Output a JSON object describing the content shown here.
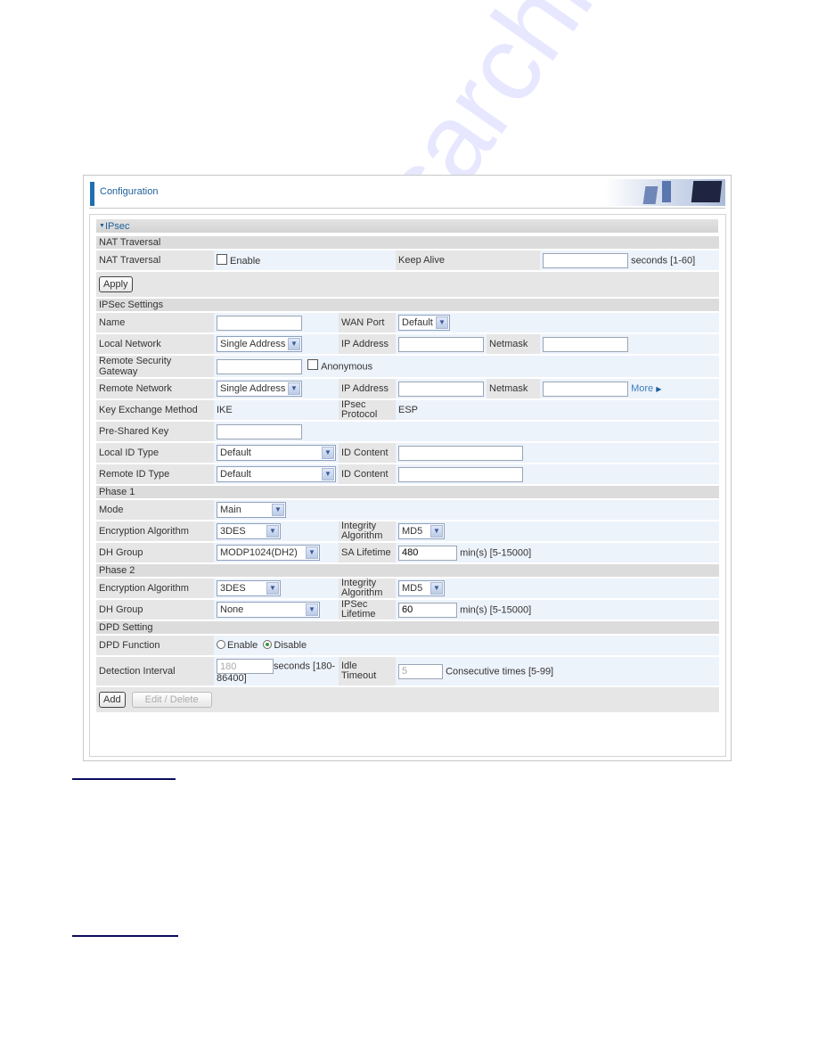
{
  "header": {
    "title": "Configuration",
    "banner": "office-chairs-monitor-banner"
  },
  "section": {
    "title": "IPsec",
    "expand_icon": "triangle-down-icon"
  },
  "nat": {
    "group": "NAT Traversal",
    "label": "NAT Traversal",
    "enable_label": "Enable",
    "enable_checked": false,
    "keepalive_label": "Keep Alive",
    "keepalive_value": "",
    "keepalive_unit": "seconds  [1-60]",
    "apply": "Apply"
  },
  "ipsec": {
    "group": "IPSec Settings",
    "name_label": "Name",
    "name_value": "",
    "wan_label": "WAN Port",
    "wan_value": "Default",
    "local_net_label": "Local Network",
    "local_net_value": "Single Address",
    "ip_label": "IP Address",
    "netmask_label": "Netmask",
    "rsg_label": "Remote Security Gateway",
    "rsg_value": "",
    "anon_label": "Anonymous",
    "anon_checked": false,
    "remote_net_label": "Remote Network",
    "remote_net_value": "Single Address",
    "more": "More",
    "kem_label": "Key Exchange Method",
    "kem_value": "IKE",
    "proto_label_1": "IPsec",
    "proto_label_2": "Protocol",
    "proto_value": "ESP",
    "psk_label": "Pre-Shared Key",
    "psk_value": "",
    "local_id_label": "Local ID Type",
    "local_id_value": "Default",
    "remote_id_label": "Remote ID Type",
    "remote_id_value": "Default",
    "id_content_label": "ID Content"
  },
  "phase1": {
    "group": "Phase 1",
    "mode_label": "Mode",
    "mode_value": "Main",
    "enc_label": "Encryption Algorithm",
    "enc_value": "3DES",
    "int_label_1": "Integrity",
    "int_label_2": "Algorithm",
    "int_value": "MD5",
    "dh_label": "DH Group",
    "dh_value": "MODP1024(DH2)",
    "sa_label": "SA Lifetime",
    "sa_value": "480",
    "sa_unit": "min(s) [5-15000]"
  },
  "phase2": {
    "group": "Phase 2",
    "enc_label": "Encryption Algorithm",
    "enc_value": "3DES",
    "int_label_1": "Integrity",
    "int_label_2": "Algorithm",
    "int_value": "MD5",
    "dh_label": "DH Group",
    "dh_value": "None",
    "life_label_1": "IPSec",
    "life_label_2": "Lifetime",
    "life_value": "60",
    "life_unit": "min(s) [5-15000]"
  },
  "dpd": {
    "group": "DPD Setting",
    "func_label": "DPD Function",
    "enable_label": "Enable",
    "disable_label": "Disable",
    "selected": "Disable",
    "interval_label": "Detection Interval",
    "interval_value": "180",
    "interval_unit_1": "seconds [180-",
    "interval_unit_2": "86400]",
    "idle_label_1": "Idle",
    "idle_label_2": "Timeout",
    "idle_value": "5",
    "idle_unit": "Consecutive times [5-99]",
    "add": "Add",
    "edit_delete": "Edit / Delete"
  },
  "watermark": "manualsarchive.com"
}
